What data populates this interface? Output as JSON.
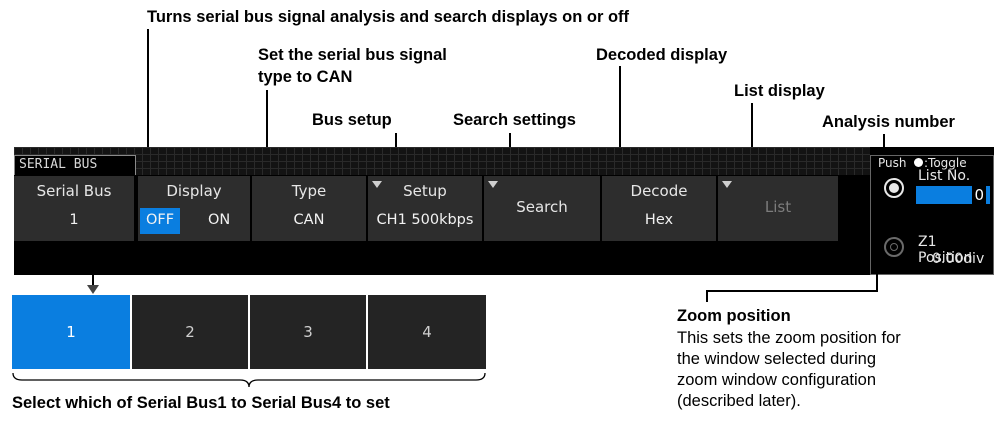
{
  "annotations": {
    "turns": "Turns serial bus signal analysis and search displays on or off",
    "type_line1": "Set the serial bus signal",
    "type_line2": "type to CAN",
    "decoded": "Decoded display",
    "list_display": "List display",
    "bus_setup": "Bus setup",
    "search_settings": "Search settings",
    "analysis_number": "Analysis number",
    "zoom_title": "Zoom position",
    "zoom_desc": [
      "This sets the zoom position for",
      "the window selected during",
      "zoom window configuration",
      "(described later)."
    ],
    "select_bus": "Select which of Serial Bus1 to Serial Bus4 to set"
  },
  "menu": {
    "tab": "SERIAL BUS",
    "keys": [
      {
        "title": "Serial Bus",
        "value": "1"
      },
      {
        "title": "Display",
        "off": "OFF",
        "on": "ON",
        "selected": "OFF"
      },
      {
        "title": "Type",
        "value": "CAN"
      },
      {
        "title": "Setup",
        "value": "CH1 500kbps"
      },
      {
        "label": "Search"
      },
      {
        "title": "Decode",
        "value": "Hex"
      },
      {
        "label": "List"
      }
    ],
    "right": {
      "push": "Push",
      "toggle": ":Toggle",
      "list_no_label": "List No.",
      "list_no_value": "0",
      "position_label": "Z1  Position",
      "position_value": "0.00div"
    }
  },
  "bus_select": {
    "options": [
      "1",
      "2",
      "3",
      "4"
    ],
    "selected": "1"
  },
  "colors": {
    "accent": "#0a7ee0",
    "key_bg": "#2d2d2d",
    "bar_bg": "#000000"
  }
}
